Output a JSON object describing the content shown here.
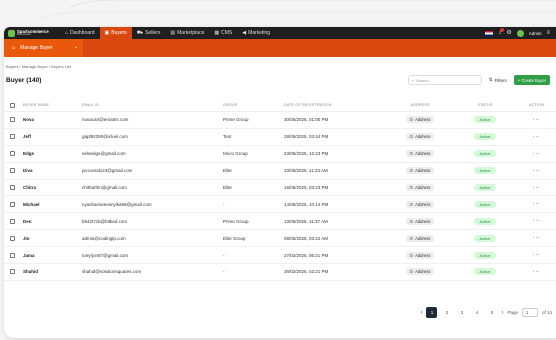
{
  "nav": {
    "brand_name": "Spartcommerce",
    "brand_sub": "Marketplace",
    "items": [
      {
        "label": "Dashboard",
        "icon": "home-icon"
      },
      {
        "label": "Buyers",
        "icon": "bag-icon",
        "active": true
      },
      {
        "label": "Sellers",
        "icon": "truck-icon"
      },
      {
        "label": "Marketplace",
        "icon": "store-icon"
      },
      {
        "label": "CMS",
        "icon": "layout-icon"
      },
      {
        "label": "Marketing",
        "icon": "megaphone-icon"
      }
    ],
    "admin_label": "Admin"
  },
  "subbar": {
    "dropdown_label": "Manage Buyer"
  },
  "breadcrumb": "Buyers / Manage Buyer / Buyers List",
  "header": {
    "title": "Buyer (140)",
    "search_placeholder": "Search",
    "filters_label": "Filters",
    "create_label": "+ Create Buyer"
  },
  "table": {
    "columns": [
      "BUYER NAME",
      "EMAIL ID",
      "GROUP",
      "DATE OF REGISTRATION",
      "ADDRESS",
      "STATUS",
      "ACTION"
    ],
    "address_label": "Address",
    "rows": [
      {
        "name": "Nova",
        "email": "novacart@ematris.com",
        "group": "Prime Group",
        "date": "30/05/2025, 01:00 PM",
        "status": "Active"
      },
      {
        "name": "Jeff",
        "email": "gapf92390@icluel.com",
        "group": "Test",
        "date": "28/05/2025, 03:44 PM",
        "status": "Active"
      },
      {
        "name": "Edge",
        "email": "eeleedge@gmail.com",
        "group": "Micro Group",
        "date": "23/05/2025, 12:23 PM",
        "status": "Active"
      },
      {
        "name": "Diva",
        "email": "piccomal123@gmail.com",
        "group": "Elite",
        "date": "23/05/2025, 11:23 AM",
        "status": "Active"
      },
      {
        "name": "Chitra",
        "email": "chitharthn@gmail.com",
        "group": "Elite",
        "date": "16/05/2025, 03:23 PM",
        "status": "Active"
      },
      {
        "name": "Michael",
        "email": "nyashanseevanyika89@gmail.com",
        "group": "-",
        "date": "14/05/2025, 10:14 PM",
        "status": "Active"
      },
      {
        "name": "Den",
        "email": "b942t7zb@bitbed.com",
        "group": "Prime Group",
        "date": "13/05/2025, 11:37 AM",
        "status": "Active"
      },
      {
        "name": "Jin",
        "email": "admin@codingtp.com",
        "group": "Elite Group",
        "date": "08/05/2025, 03:22 AM",
        "status": "Active"
      },
      {
        "name": "Jama",
        "email": "tonyrjon87@gmail.com",
        "group": "-",
        "date": "27/02/2025, 06:21 PM",
        "status": "Active"
      },
      {
        "name": "Shahid",
        "email": "shahid@solutionsquares.com",
        "group": "-",
        "date": "26/02/2025, 02:21 PM",
        "status": "Active"
      }
    ]
  },
  "pagination": {
    "pages": [
      "1",
      "2",
      "3",
      "4",
      "5"
    ],
    "current": "1",
    "page_label": "Page",
    "page_value": "1",
    "of_label": "of 14"
  },
  "colors": {
    "accent": "#d9480f",
    "topbar": "#1f1f1f",
    "primary_button": "#2f9e44",
    "status_active_bg": "#d3f9d8"
  }
}
